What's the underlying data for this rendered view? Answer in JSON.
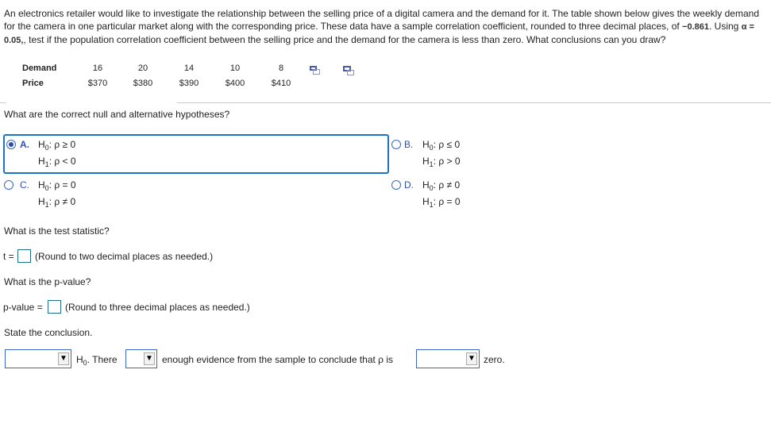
{
  "intro": {
    "text_1": "An electronics retailer would like to investigate the relationship between the selling price of a digital camera and the demand for it. The table shown below gives the weekly demand for the camera in one particular market along with the corresponding price. These data have a sample correlation coefficient, rounded to three decimal places, of ",
    "r_value": "−0.861",
    "text_2": ". Using ",
    "alpha": "α = 0.05,",
    "text_3": ", test if the population correlation coefficient between the selling price and the demand for the camera is less than zero. What conclusions can you draw?"
  },
  "data_table": {
    "rows": [
      {
        "label": "Demand",
        "values": [
          "16",
          "20",
          "14",
          "10",
          "8"
        ]
      },
      {
        "label": "Price",
        "values": [
          "$370",
          "$380",
          "$390",
          "$400",
          "$410"
        ]
      }
    ],
    "icons": [
      "copy-data-icon",
      "open-data-icon"
    ]
  },
  "q1": {
    "question": "What are the correct null and alternative hypotheses?",
    "options": [
      {
        "letter": "A.",
        "h0": "ρ ≥ 0",
        "h1": "ρ < 0",
        "selected": true
      },
      {
        "letter": "B.",
        "h0": "ρ ≤ 0",
        "h1": "ρ > 0",
        "selected": false
      },
      {
        "letter": "C.",
        "h0": "ρ = 0",
        "h1": "ρ ≠ 0",
        "selected": false
      },
      {
        "letter": "D.",
        "h0": "ρ ≠ 0",
        "h1": "ρ = 0",
        "selected": false
      }
    ],
    "h0_label": "H",
    "h0_sub": "0",
    "h1_label": "H",
    "h1_sub": "1"
  },
  "q2": {
    "question": "What is the test statistic?",
    "prefix": "t =",
    "value": "",
    "hint": "(Round to two decimal places as needed.)"
  },
  "q3": {
    "question": "What is the p-value?",
    "prefix": "p-value =",
    "value": "",
    "hint": "(Round to three decimal places as needed.)"
  },
  "q4": {
    "question": "State the conclusion.",
    "dropdown1_value": "",
    "text_h": "H",
    "text_h_sub": "0",
    "text_there": ". There",
    "dropdown2_value": "",
    "text_middle": "enough evidence from the sample to conclude that ρ is",
    "dropdown3_value": "",
    "text_end": "zero.",
    "arrow_glyph": "▼"
  }
}
